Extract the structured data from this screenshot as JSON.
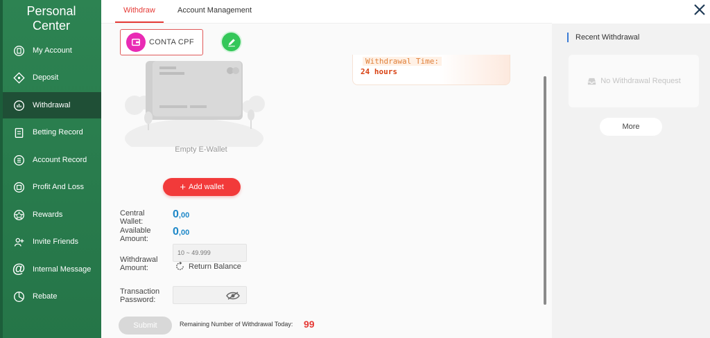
{
  "sidebar": {
    "title": "Personal Center",
    "items": [
      {
        "label": "My Account",
        "icon": "account-icon"
      },
      {
        "label": "Deposit",
        "icon": "deposit-icon"
      },
      {
        "label": "Withdrawal",
        "icon": "withdrawal-icon",
        "active": true
      },
      {
        "label": "Betting Record",
        "icon": "betting-record-icon"
      },
      {
        "label": "Account Record",
        "icon": "account-record-icon"
      },
      {
        "label": "Profit And Loss",
        "icon": "profit-loss-icon"
      },
      {
        "label": "Rewards",
        "icon": "rewards-icon"
      },
      {
        "label": "Invite Friends",
        "icon": "invite-friends-icon"
      },
      {
        "label": "Internal Message",
        "icon": "at-icon"
      },
      {
        "label": "Rebate",
        "icon": "rebate-icon"
      }
    ]
  },
  "tabs": [
    {
      "label": "Withdraw",
      "active": true
    },
    {
      "label": "Account Management"
    }
  ],
  "wallet": {
    "conta_label": "CONTA CPF",
    "empty_label": "Empty E-Wallet",
    "add_wallet_label": "Add wallet"
  },
  "withdrawal_time": {
    "title": "Withdrawal Time:",
    "value": "24 hours"
  },
  "form": {
    "central_wallet_label": "Central Wallet:",
    "central_wallet_int": "0",
    "central_wallet_dec": ",00",
    "available_label": "Available Amount:",
    "available_int": "0",
    "available_dec": ",00",
    "withdrawal_amount_label": "Withdrawal Amount:",
    "withdrawal_placeholder": "10 ~ 49.999",
    "return_balance_label": "Return Balance",
    "password_label": "Transaction Password:",
    "submit_label": "Submit",
    "remaining_label": "Remaining Number of Withdrawal Today:",
    "remaining_count": "99"
  },
  "recent": {
    "title": "Recent Withdrawal",
    "empty_text": "No Withdrawal Request",
    "more_label": "More"
  },
  "colors": {
    "sidebar": "#2a7a4f",
    "accent": "#e53935",
    "amount": "#1e88c8",
    "add_wallet": "#f23a3a",
    "edit": "#34c759",
    "conta_icon": "#e92bb4"
  }
}
